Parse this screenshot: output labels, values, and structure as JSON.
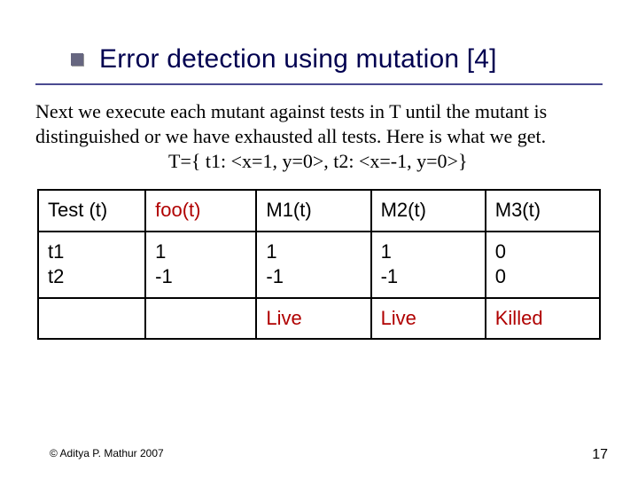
{
  "title": "Error detection using mutation [4]",
  "body": "Next we execute each mutant against tests in T until the mutant is distinguished or we have exhausted all tests. Here is what we get.",
  "tset": "T={ t1: <x=1, y=0>, t2: <x=-1, y=0>}",
  "table": {
    "header": [
      "Test (t)",
      "foo(t)",
      "M1(t)",
      "M2(t)",
      "M3(t)"
    ],
    "row_tests": "t1\nt2",
    "row_foo": "1\n-1",
    "row_m1": "1\n-1",
    "row_m2": "1\n-1",
    "row_m3": "0\n0",
    "status_m1": "Live",
    "status_m2": "Live",
    "status_m3": "Killed"
  },
  "footer": {
    "copyright": "© Aditya P. Mathur 2007",
    "page": "17"
  }
}
